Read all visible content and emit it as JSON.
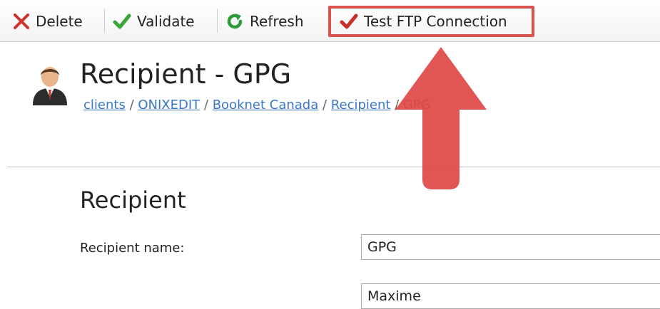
{
  "toolbar": {
    "delete_label": "Delete",
    "validate_label": "Validate",
    "refresh_label": "Refresh",
    "test_ftp_label": "Test FTP Connection"
  },
  "header": {
    "title": "Recipient - GPG",
    "breadcrumb": {
      "items": [
        "clients",
        "ONIXEDIT",
        "Booknet Canada",
        "Recipient"
      ],
      "separator": "/",
      "current": "GPG"
    }
  },
  "form": {
    "section_title": "Recipient",
    "recipient_name_label": "Recipient name:",
    "recipient_name_value": "GPG",
    "contact_value": "Maxime"
  },
  "colors": {
    "highlight": "#d9534f",
    "link": "#3a78c3",
    "delete_icon": "#d0312d",
    "check_icon": "#3aa63a",
    "test_check_icon": "#c9302c"
  }
}
